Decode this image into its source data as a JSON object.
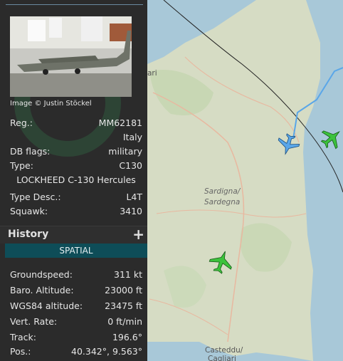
{
  "map": {
    "labels": {
      "region_line1": "Sardigna/",
      "region_line2": "Sardegna",
      "city_line1": "Casteddu/",
      "city_line2": "Cagliari",
      "partial_top": "ari"
    }
  },
  "aircraft_info": {
    "image_credit": "Image © Justin Stöckel",
    "reg_label": "Reg.:",
    "reg_value": "MM62181",
    "country": "Italy",
    "db_flags_label": "DB flags:",
    "db_flags_value": "military",
    "type_label": "Type:",
    "type_value": "C130",
    "type_full": "LOCKHEED C-130 Hercules",
    "type_desc_label": "Type Desc.:",
    "type_desc_value": "L4T",
    "squawk_label": "Squawk:",
    "squawk_value": "3410"
  },
  "history": {
    "title": "History",
    "expand": "+"
  },
  "spatial": {
    "title": "SPATIAL",
    "groundspeed_label": "Groundspeed:",
    "groundspeed_value": "311 kt",
    "baro_label": "Baro. Altitude:",
    "baro_value": "23000 ft",
    "wgs84_label": "WGS84 altitude:",
    "wgs84_value": "23475 ft",
    "vert_label": "Vert. Rate:",
    "vert_value": "0 ft/min",
    "track_label": "Track:",
    "track_value": "196.6°",
    "pos_label": "Pos.:",
    "pos_value": "40.342°, 9.563°"
  },
  "colors": {
    "selected_aircraft": "#5aa6e8",
    "other_aircraft": "#3cc23c",
    "panel_bg": "#2b2b2b",
    "spatial_header": "#0e4d58"
  }
}
